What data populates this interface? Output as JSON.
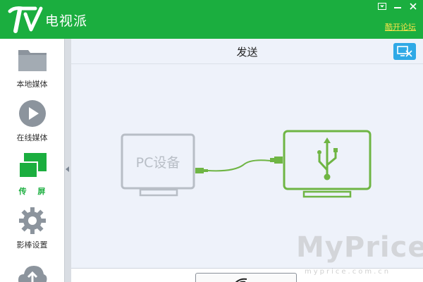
{
  "app": {
    "title": "电视派",
    "forum_link": "酷开论坛",
    "logo_icon": "tv-logo-icon",
    "brand_color": "#1bae3f"
  },
  "window_controls": [
    {
      "icon": "dropdown-icon"
    },
    {
      "icon": "minimize-icon"
    },
    {
      "icon": "close-icon"
    }
  ],
  "sidebar": {
    "items": [
      {
        "label": "本地媒体",
        "icon": "folder-icon",
        "active": false
      },
      {
        "label": "在线媒体",
        "icon": "play-icon",
        "active": false
      },
      {
        "label": "传 屏",
        "icon": "screen-mirror-icon",
        "active": true
      },
      {
        "label": "影棒设置",
        "icon": "gear-icon",
        "active": false
      },
      {
        "label": "",
        "icon": "cloud-upload-icon",
        "active": false
      }
    ]
  },
  "main": {
    "title": "发送",
    "header_button_icon": "screen-cast-icon",
    "pc_label": "PC设备",
    "usb_icon": "usb-icon"
  },
  "watermark": {
    "text": "MyPrice",
    "sub": "myprice.com.cn"
  }
}
